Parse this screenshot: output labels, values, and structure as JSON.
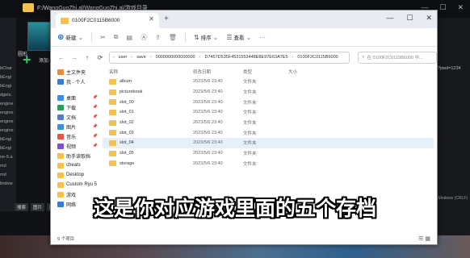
{
  "bg": {
    "path": "F:/WangGuoZhi.al/WangGuoZhi.al/游戏目录",
    "thumb_label": "圆形",
    "add_label": "添加",
    "left_list": [
      "bChar",
      "bEngi",
      "bEngi",
      "dgets.",
      "engine",
      "engine",
      "engine",
      "engine",
      "bEngi",
      "bEngi",
      "ne-5.a",
      "md",
      "md",
      "lindow"
    ],
    "right_text": "?pwd=1234",
    "right_text2": "Windows (CRLF)",
    "bottom_tabs": [
      "搜索",
      "图片",
      "图片"
    ]
  },
  "window": {
    "tab_title": "0100F2C0115B6000",
    "toolbar": {
      "new": "新建",
      "sort": "排序",
      "view": "查看"
    },
    "address": {
      "crumbs": [
        "user",
        "save",
        "0000000000000000",
        "D7457D535F4531553448E8E97E63A7E5",
        "0100F2C0115B6000"
      ],
      "search_placeholder": "在 0100F2C0115B6000 中..."
    },
    "nav": [
      {
        "label": "主文件夹",
        "color": "#e58f3c"
      },
      {
        "label": "我 - 个人",
        "color": "#3a7bd5"
      },
      {
        "label": "桌面",
        "color": "#3a8ee6"
      },
      {
        "label": "下载",
        "color": "#2a9d5c"
      },
      {
        "label": "文档",
        "color": "#5a7fbf"
      },
      {
        "label": "图片",
        "color": "#3e8ed0"
      },
      {
        "label": "音乐",
        "color": "#e2584a"
      },
      {
        "label": "视频",
        "color": "#7a55c7"
      },
      {
        "label": "助手读取档",
        "color": "#f2c14e"
      },
      {
        "label": "cheats",
        "color": "#f2c14e"
      },
      {
        "label": "Desktop",
        "color": "#f2c14e"
      },
      {
        "label": "Custom Ryu 5",
        "color": "#f2c14e"
      },
      {
        "label": "游戏",
        "color": "#f2c14e"
      },
      {
        "label": "网络",
        "color": "#3a7bd5"
      }
    ],
    "columns": [
      "名称",
      "修改日期",
      "类型",
      "大小"
    ],
    "files": [
      {
        "name": "album",
        "date": "2023/5/6 23:40",
        "type": "文件夹"
      },
      {
        "name": "picturebook",
        "date": "2023/5/6 23:40",
        "type": "文件夹"
      },
      {
        "name": "slot_00",
        "date": "2023/5/6 23:40",
        "type": "文件夹"
      },
      {
        "name": "slot_01",
        "date": "2023/5/6 23:40",
        "type": "文件夹"
      },
      {
        "name": "slot_02",
        "date": "2023/5/6 23:40",
        "type": "文件夹"
      },
      {
        "name": "slot_03",
        "date": "2023/5/6 23:40",
        "type": "文件夹"
      },
      {
        "name": "slot_04",
        "date": "2023/5/6 23:40",
        "type": "文件夹"
      },
      {
        "name": "slot_05",
        "date": "2023/5/6 23:40",
        "type": "文件夹"
      },
      {
        "name": "storage",
        "date": "2023/5/6 23:40",
        "type": "文件夹"
      }
    ],
    "status": "9 个项目"
  },
  "subtitle": "这是你对应游戏里面的五个存档"
}
